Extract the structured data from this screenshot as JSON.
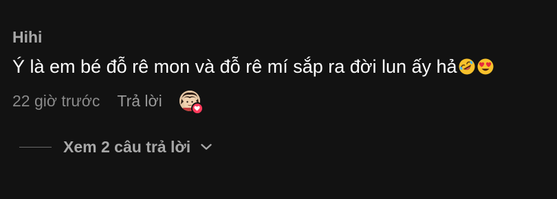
{
  "comment": {
    "username": "Hihi",
    "text": "Ý là em bé đỗ rê mon và đỗ rê mí sắp ra đời lun ấy hả",
    "emojis": [
      "rolling-on-floor-laughing-emoji",
      "heart-eyes-emoji"
    ],
    "timestamp": "22 giờ trước",
    "reply_label": "Trả lời",
    "liked_by_creator": true,
    "colors": {
      "background": "#121212",
      "username": "#a8a8a8",
      "text": "#ffffff",
      "meta": "#8a8a8a",
      "heart": "#ff3b5c"
    }
  },
  "replies": {
    "label": "Xem 2 câu trả lời",
    "icon": "chevron-down-icon"
  }
}
